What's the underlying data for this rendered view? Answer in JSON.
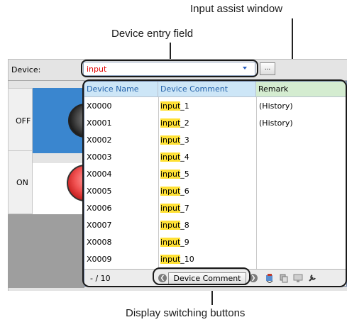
{
  "callouts": {
    "input_assist": "Input assist window",
    "device_entry": "Device entry field",
    "display_switching": "Display switching buttons"
  },
  "device_field": {
    "label": "Device:",
    "value": "input",
    "browse_label": "..."
  },
  "states": [
    "OFF",
    "ON"
  ],
  "assist": {
    "headers": {
      "name": "Device Name",
      "comment": "Device Comment",
      "remark": "Remark"
    },
    "rows": [
      {
        "name": "X0000",
        "hl": "input",
        "rest": "_1",
        "remark": "(History)"
      },
      {
        "name": "X0001",
        "hl": "input",
        "rest": "_2",
        "remark": "(History)"
      },
      {
        "name": "X0002",
        "hl": "input",
        "rest": "_3",
        "remark": ""
      },
      {
        "name": "X0003",
        "hl": "input",
        "rest": "_4",
        "remark": ""
      },
      {
        "name": "X0004",
        "hl": "input",
        "rest": "_5",
        "remark": ""
      },
      {
        "name": "X0005",
        "hl": "input",
        "rest": "_6",
        "remark": ""
      },
      {
        "name": "X0006",
        "hl": "input",
        "rest": "_7",
        "remark": ""
      },
      {
        "name": "X0007",
        "hl": "input",
        "rest": "_8",
        "remark": ""
      },
      {
        "name": "X0008",
        "hl": "input",
        "rest": "_9",
        "remark": ""
      },
      {
        "name": "X0009",
        "hl": "input",
        "rest": "_10",
        "remark": ""
      }
    ],
    "footer": {
      "page_info": "- / 10",
      "prev_glyph": "❮",
      "next_glyph": "❯",
      "mode_label": "Device Comment"
    }
  },
  "colors": {
    "accent_blue": "#3a86cf",
    "highlight": "#ffe135",
    "entry_text": "#e00000"
  }
}
